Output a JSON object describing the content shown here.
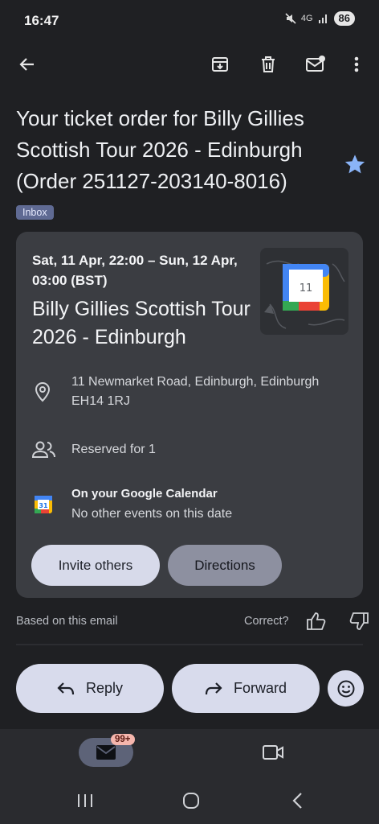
{
  "status": {
    "time": "16:47",
    "network": "4G",
    "battery": "86"
  },
  "email": {
    "subject": "Your ticket order for Billy Gillies Scottish Tour 2026 - Edinburgh (Order 251127-203140-8016)",
    "label": "Inbox"
  },
  "event": {
    "datetime": "Sat, 11 Apr, 22:00 – Sun, 12 Apr, 03:00 (BST)",
    "title": "Billy Gillies Scottish Tour 2026 - Edinburgh",
    "calendar_day": "11",
    "address": "11 Newmarket Road, Edinburgh, Edinburgh EH14 1RJ",
    "reserved": "Reserved for 1",
    "calendar_title": "On your Google Calendar",
    "calendar_note": "No other events on this date",
    "calendar_icon_day": "31",
    "invite_label": "Invite others",
    "directions_label": "Directions"
  },
  "feedback": {
    "based_on": "Based on this email",
    "correct": "Correct?"
  },
  "actions": {
    "reply": "Reply",
    "forward": "Forward"
  },
  "nav": {
    "mail_badge": "99+"
  },
  "colors": {
    "background": "#1f2023",
    "card": "#3b3d42",
    "star": "#8ab4f8",
    "badge": "#5f6a93"
  }
}
